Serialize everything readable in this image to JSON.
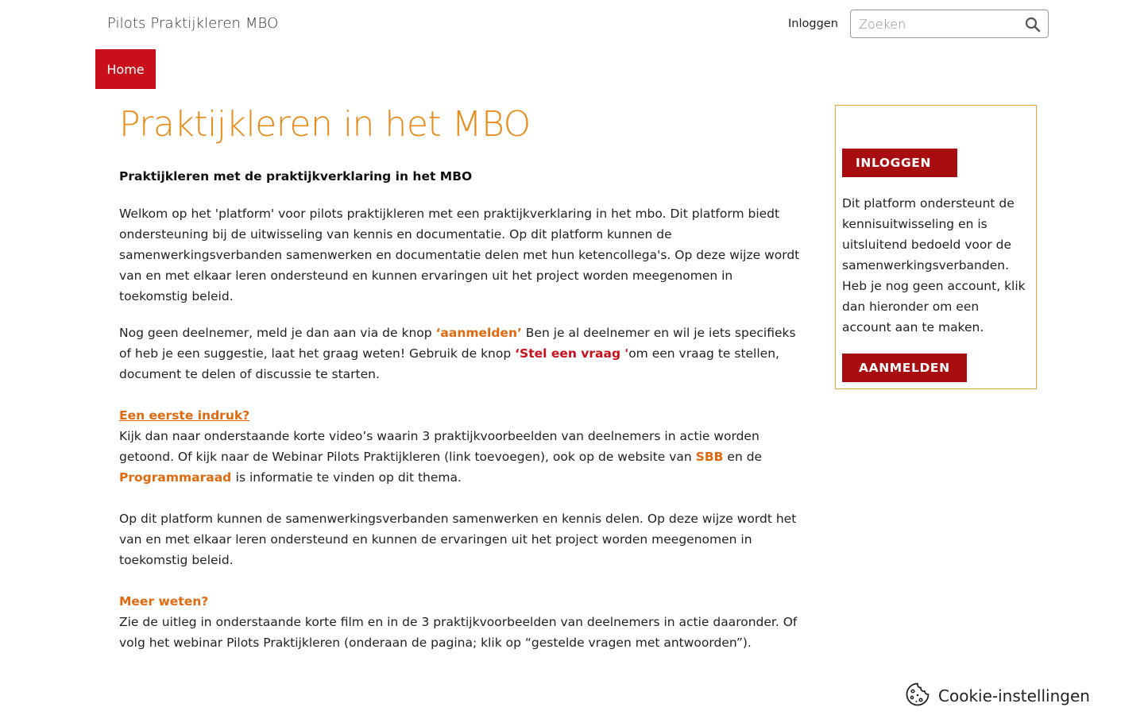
{
  "header": {
    "site_title": "Pilots Praktijkleren MBO",
    "login_label": "Inloggen",
    "search_placeholder": "Zoeken"
  },
  "nav": {
    "home_label": "Home"
  },
  "main": {
    "title": "Praktijkleren in het MBO",
    "subtitle": "Praktijkleren met de praktijkverklaring in het MBO",
    "intro": "Welkom op het 'platform' voor pilots praktijkleren met een praktijkverklaring in het mbo. Dit platform biedt ondersteuning bij de uitwisseling van kennis en documentatie. Op dit platform kunnen de samenwerkingsverbanden samenwerken en documentatie delen met hun ketencollega's. Op deze wijze wordt van en met elkaar leren ondersteund en kunnen ervaringen uit het project worden meegenomen in toekomstig beleid.",
    "para2": {
      "part1": "Nog geen deelnemer, meld je dan aan via de knop ",
      "link1": "‘aanmelden’",
      "part2": " Ben je al deelnemer en wil je iets specifieks of heb je een suggestie, laat het graag weten! Gebruik de knop ",
      "link2": "‘Stel een vraag '",
      "part3": "om een vraag te stellen, document te delen of discussie te starten."
    },
    "section1": {
      "heading": "Een eerste indruk?",
      "part1": "Kijk dan naar onderstaande korte video’s waarin 3 praktijkvoorbeelden van deelnemers in actie worden getoond. Of kijk naar de Webinar Pilots Praktijkleren (link toevoegen), ook op de website van ",
      "link_sbb": "SBB",
      "part2": " en de ",
      "link_programmaraad": "Programmaraad ",
      "part3": " is informatie te vinden op dit thema."
    },
    "para4": "Op dit platform kunnen de samenwerkingsverbanden samenwerken en kennis delen. Op deze wijze wordt het van en met elkaar leren ondersteund en kunnen de ervaringen uit het project worden meegenomen in toekomstig beleid.",
    "section2": {
      "heading": "Meer weten?",
      "text": "Zie de uitleg in onderstaande korte film en in de 3 praktijkvoorbeelden van deelnemers in actie daaronder. Of volg het webinar Pilots Praktijkleren (onderaan de pagina; klik op “gestelde vragen met antwoorden”)."
    }
  },
  "sidebar": {
    "login_button": "INLOGGEN",
    "text": "Dit platform ondersteunt de kennisuitwisseling en is uitsluitend bedoeld voor de samenwerkingsverbanden. Heb je nog geen account, klik dan hieronder om een account aan te maken.",
    "signup_button": "AANMELDEN"
  },
  "cookie": {
    "label": "Cookie-instellingen",
    "icon": "cookie-icon"
  },
  "colors": {
    "accent_red": "#c80f1a",
    "button_dark_red": "#a80d10",
    "title_orange": "#e88a17",
    "link_orange": "#e0690e",
    "sidebar_border": "#e6a33a"
  }
}
